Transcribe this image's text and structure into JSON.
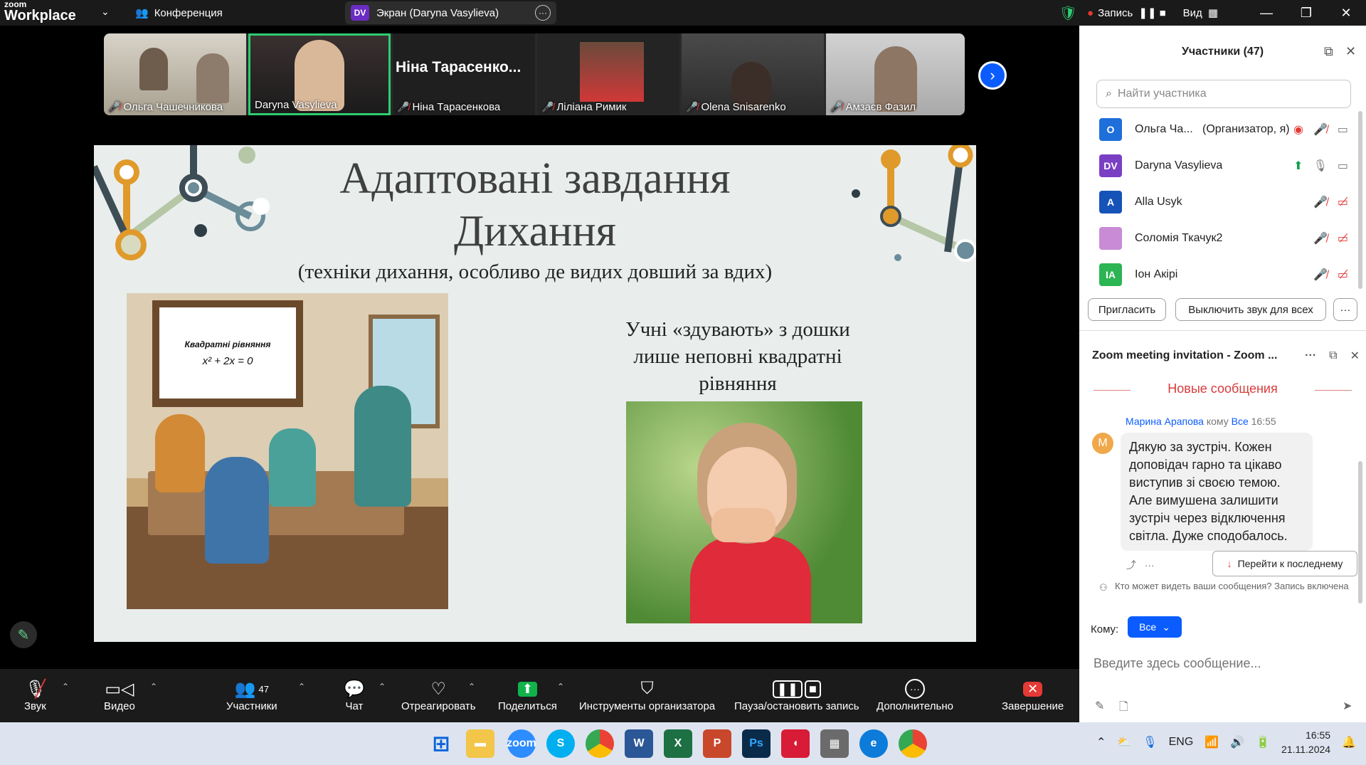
{
  "app": {
    "brand_top": "zoom",
    "brand_bottom": "Workplace",
    "conference_label": "Конференция"
  },
  "screen_share": {
    "badge": "DV",
    "label": "Экран (Daryna Vasylieva)"
  },
  "topbar": {
    "recording_label": "Запись",
    "view_label": "Вид"
  },
  "filmstrip": [
    {
      "name": "Ольга Чашечникова",
      "muted": true
    },
    {
      "name": "Daryna Vasylieva",
      "muted": false,
      "selected": true
    },
    {
      "name": "Ніна Тарасенкова",
      "muted": true,
      "big_name": "Ніна  Тарасенко..."
    },
    {
      "name": "Ліліана Римик",
      "muted": true
    },
    {
      "name": "Olena Snisarenko",
      "muted": true
    },
    {
      "name": "Амзаєв Фазил",
      "muted": true
    }
  ],
  "slide": {
    "title_line1": "Адаптовані завдання",
    "title_line2": "Дихання",
    "subtitle": "(техніки дихання, особливо де видих довший за вдих)",
    "caption": "Учні «здувають» з дошки лише неповні квадратні рівняння",
    "board_title": "Квадратні рівняння",
    "board_eq": "x² + 2x  = 0"
  },
  "toolbar": {
    "audio": "Звук",
    "video": "Видео",
    "participants": "Участники",
    "participants_count": "47",
    "chat": "Чат",
    "react": "Отреагировать",
    "share": "Поделиться",
    "host_tools": "Инструменты организатора",
    "pause_record": "Пауза/остановить запись",
    "more": "Дополнительно",
    "end": "Завершение"
  },
  "participants_panel": {
    "title": "Участники (47)",
    "search_placeholder": "Найти участника",
    "rows": [
      {
        "initials": "O",
        "name": "Ольга Ча...",
        "role": "(Организатор, я)",
        "color": "#1e6fd9"
      },
      {
        "initials": "DV",
        "name": "Daryna Vasylieva",
        "role": "",
        "color": "#7b3fc4"
      },
      {
        "initials": "A",
        "name": "Alla Usyk",
        "role": "",
        "color": "#1553b8"
      },
      {
        "initials": "",
        "name": "Соломія Ткачук2",
        "role": "",
        "color": "#c98ad6"
      },
      {
        "initials": "IA",
        "name": "Іон Акірі",
        "role": "",
        "color": "#2cb553"
      }
    ],
    "invite_button": "Пригласить",
    "mute_all_button": "Выключить звук для всех",
    "more_button": "···"
  },
  "chat_panel": {
    "title": "Zoom meeting invitation - Zoom ...",
    "new_messages": "Новые сообщения",
    "message": {
      "sender": "Марина Арапова",
      "to_word": "кому",
      "to": "Все",
      "time": "16:55",
      "avatar": "M",
      "text": "Дякую за зустріч. Кожен доповідач гарно та цікаво виступив зі своєю темою. Але вимушена залишити зустріч через відключення світла. Дуже сподобалось."
    },
    "goto_last": "Перейти к последнему",
    "privacy_note": "Кто может видеть ваши сообщения? Запись включена",
    "to_label": "Кому:",
    "to_value": "Все",
    "input_placeholder": "Введите здесь сообщение..."
  },
  "taskbar": {
    "lang": "ENG",
    "time": "16:55",
    "date": "21.11.2024"
  }
}
